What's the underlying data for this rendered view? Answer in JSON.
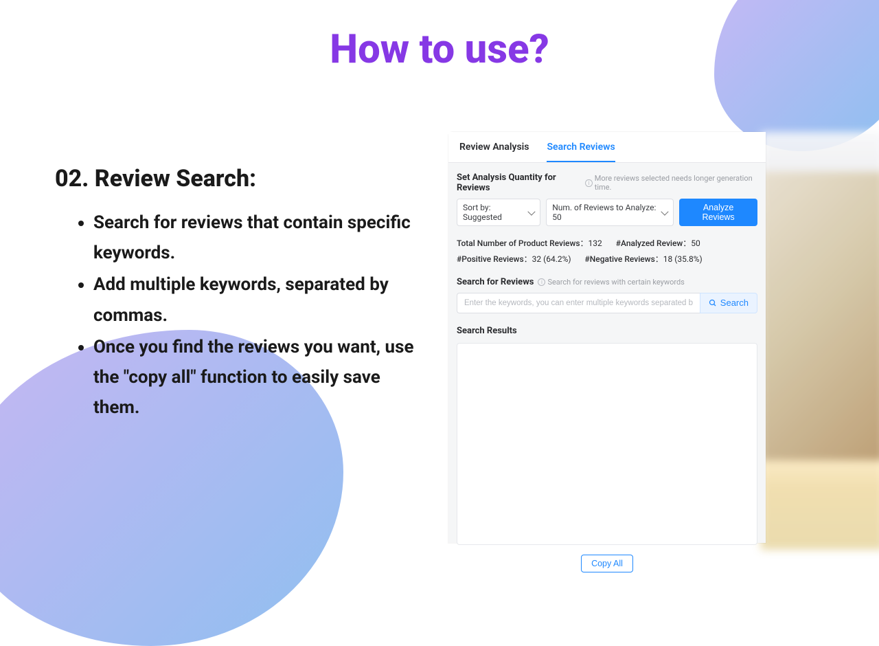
{
  "page_title": "How to use?",
  "section": {
    "heading": "02. Review Search:",
    "bullets": [
      "Search for reviews that contain specific keywords.",
      "Add multiple keywords, separated by commas.",
      "Once you find the reviews you want, use the \"copy all\" function to easily save them."
    ]
  },
  "panel": {
    "tabs": {
      "review_analysis": "Review Analysis",
      "search_reviews": "Search Reviews"
    },
    "set_quantity": {
      "title": "Set Analysis Quantity for Reviews",
      "hint": "More reviews selected needs longer generation time.",
      "sort_label": "Sort by: Suggested",
      "num_label": "Num. of Reviews to Analyze:  50",
      "analyze_button": "Analyze Reviews"
    },
    "stats": {
      "total_label": "Total Number of Product Reviews：",
      "total_value": "132",
      "analyzed_label": "#Analyzed Review：",
      "analyzed_value": "50",
      "positive_label": "#Positive Reviews：",
      "positive_value": "32 (64.2%)",
      "negative_label": "#Negative Reviews：",
      "negative_value": "18 (35.8%)"
    },
    "search": {
      "title": "Search for Reviews",
      "hint": "Search for reviews with certain keywords",
      "placeholder": "Enter the keywords, you can enter multiple keywords separated by commas",
      "button": "Search"
    },
    "results_title": "Search Results",
    "copy_all": "Copy All"
  }
}
